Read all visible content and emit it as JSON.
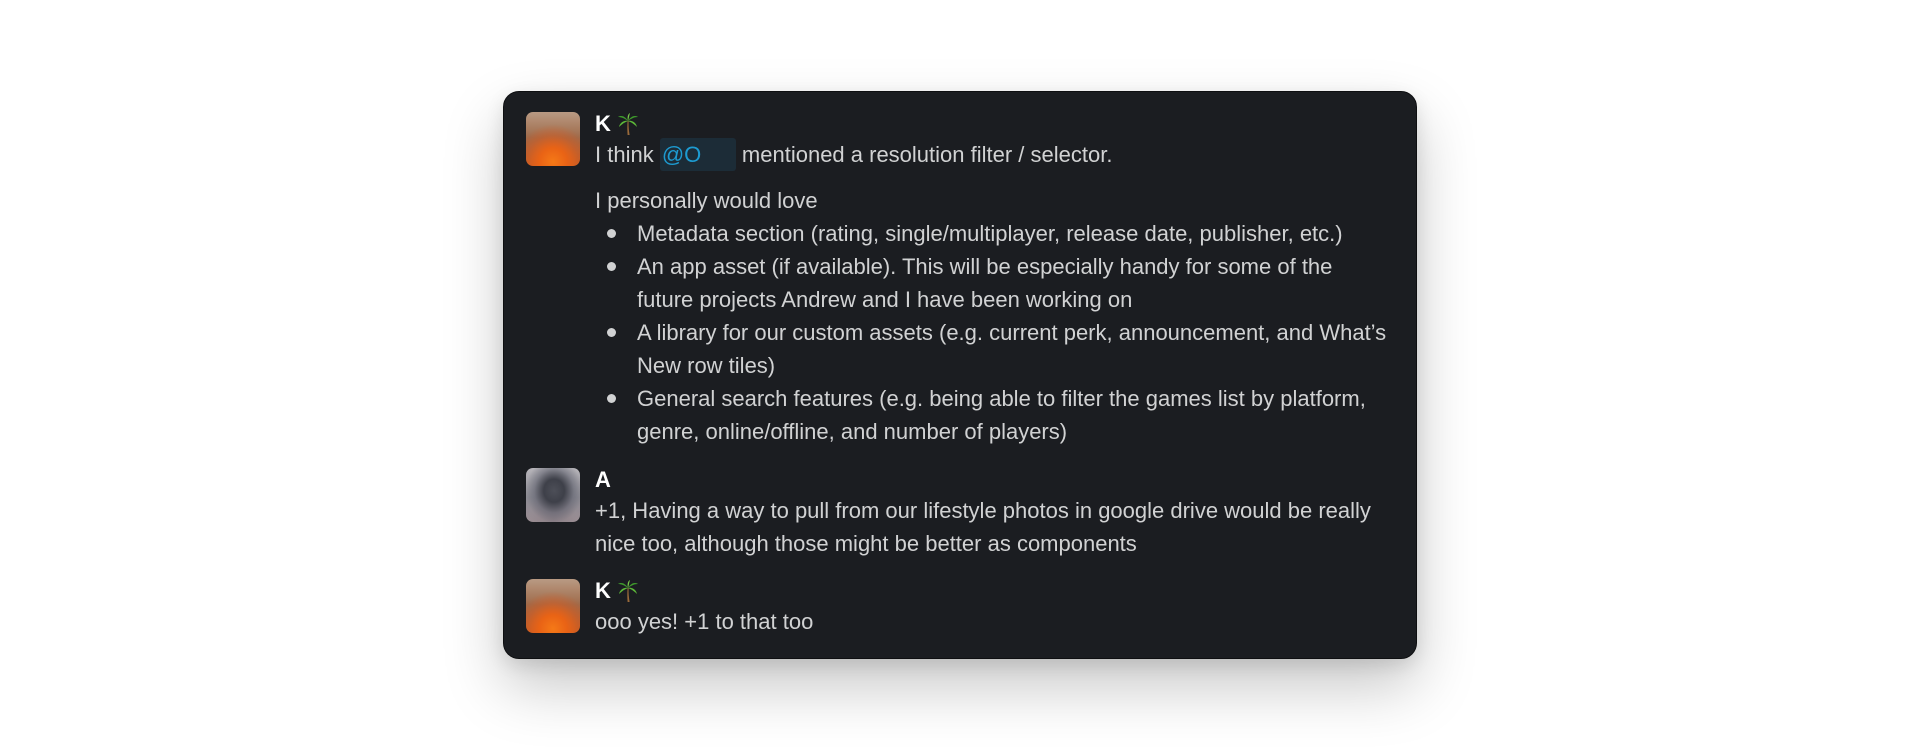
{
  "messages": [
    {
      "sender": "K",
      "status_icon": "palm-tree-icon",
      "line1": {
        "before": "I think ",
        "mention": "@O",
        "after": " mentioned a resolution filter / selector."
      },
      "intro": "I personally would love",
      "bullets": [
        "Metadata section (rating, single/multiplayer, release date, publisher, etc.)",
        "An app asset (if available). This will be especially handy for some of the future projects Andrew and I have been working on",
        "A library for our custom assets (e.g. current perk, announcement, and What’s New row tiles)",
        "General search features (e.g. being able to filter the games list by platform, genre, online/offline, and number of players)"
      ]
    },
    {
      "sender": "A",
      "text": "+1, Having a way to pull from our lifestyle photos in google drive would be really nice too, although those might be better as components"
    },
    {
      "sender": "K",
      "status_icon": "palm-tree-icon",
      "text": "ooo yes! +1 to that too"
    }
  ],
  "colors": {
    "card_background": "#1b1d21",
    "text": "#d1d2d3",
    "sender": "#ffffff",
    "mention_text": "#1d9bd1",
    "mention_background": "#1c2c37"
  }
}
